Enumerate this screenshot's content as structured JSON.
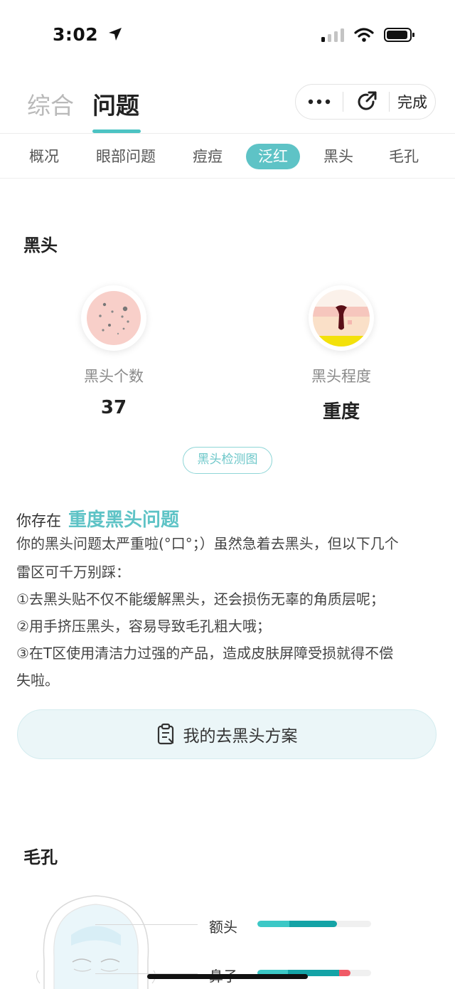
{
  "status_bar": {
    "time": "3:02"
  },
  "header": {
    "tabs": [
      {
        "label": "综合",
        "active": false
      },
      {
        "label": "问题",
        "active": true
      }
    ],
    "capsule": {
      "more_icon": "more-dots-icon",
      "refresh_icon": "share-refresh-icon",
      "done_label": "完成"
    }
  },
  "subnav": {
    "items": [
      {
        "label": "概况",
        "active": false
      },
      {
        "label": "眼部问题",
        "active": false
      },
      {
        "label": "痘痘",
        "active": false
      },
      {
        "label": "泛红",
        "active": true
      },
      {
        "label": "黑头",
        "active": false
      },
      {
        "label": "毛孔",
        "active": false
      }
    ]
  },
  "blackhead": {
    "title": "黑头",
    "count": {
      "label": "黑头个数",
      "value": "37"
    },
    "severity": {
      "label": "黑头程度",
      "value": "重度"
    },
    "detect_button": "黑头检测图",
    "exist_prefix": "你存在",
    "exist_problem": "重度黑头问题",
    "description_lines": [
      "你的黑头问题太严重啦(°口°；）虽然急着去黑头，但以下几个",
      "雷区可千万别踩：",
      "①去黑头贴不仅不能缓解黑头，还会损伤无辜的角质层呢；",
      "②用手挤压黑头，容易导致毛孔粗大哦；",
      "③在T区使用清洁力过强的产品，造成皮肤屏障受损就得不偿",
      "失啦。"
    ],
    "plan_button": "我的去黑头方案"
  },
  "pores": {
    "title": "毛孔",
    "rows": [
      {
        "label": "额头",
        "level": 0.7,
        "colors": [
          "#3cc8c6",
          "#14a3a6"
        ]
      },
      {
        "label": "鼻子",
        "level": 0.82,
        "colors": [
          "#3cc8c6",
          "#14a3a6",
          "#f05a66"
        ]
      }
    ]
  },
  "colors": {
    "accent": "#5ec3c6",
    "accent_dark": "#14a3a6",
    "danger": "#f05a66"
  }
}
